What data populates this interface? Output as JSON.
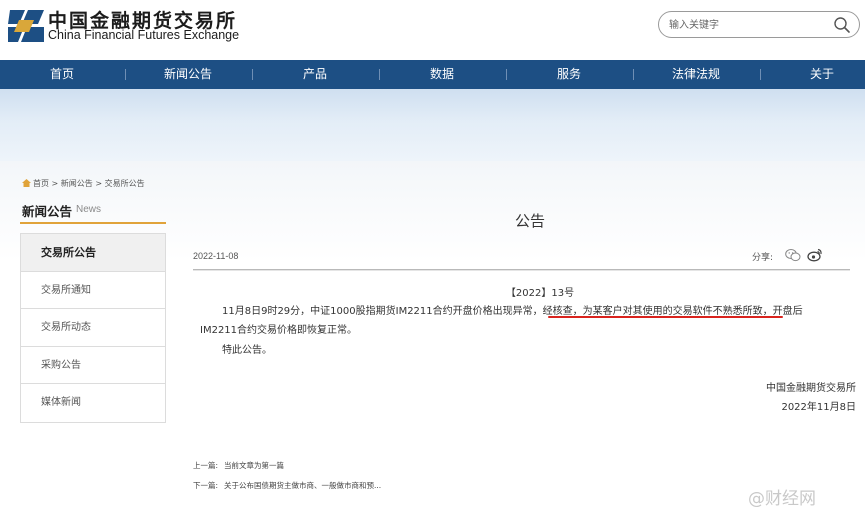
{
  "header": {
    "org_name_cn": "中国金融期货交易所",
    "org_name_en": "China Financial Futures Exchange",
    "search_placeholder": "输入关键字",
    "brand_colors": {
      "primary": "#1d4f84",
      "accent": "#e0a33a",
      "highlight": "#d9231e"
    }
  },
  "nav": {
    "items": [
      {
        "label": "首页"
      },
      {
        "label": "新闻公告"
      },
      {
        "label": "产品"
      },
      {
        "label": "数据"
      },
      {
        "label": "服务"
      },
      {
        "label": "法律法规"
      },
      {
        "label": "关于"
      }
    ]
  },
  "breadcrumb": {
    "home": "首页",
    "sep": ">",
    "level1": "新闻公告",
    "level2": "交易所公告"
  },
  "sidebar": {
    "title": "新闻公告",
    "title_en": "News",
    "items": [
      {
        "label": "交易所公告",
        "active": true
      },
      {
        "label": "交易所通知"
      },
      {
        "label": "交易所动态"
      },
      {
        "label": "采购公告"
      },
      {
        "label": "媒体新闻"
      }
    ]
  },
  "article": {
    "title": "公告",
    "date": "2022-11-08",
    "share_label": "分享:",
    "share_icons": [
      "wechat-icon",
      "weibo-icon"
    ],
    "doc_number": "【2022】13号",
    "para1_line1": "11月8日9时29分，中证1000股指期货IM2211合约开盘价格出现异常，经核查，为某客户对其使用的交易软件不熟悉所致，开盘后",
    "para1_line2": "IM2211合约交易价格即恢复正常。",
    "para2": "特此公告。",
    "signature_org": "中国金融期货交易所",
    "signature_date": "2022年11月8日"
  },
  "pager": {
    "prev_label": "上一篇:",
    "prev_value": "当前文章为第一篇",
    "next_label": "下一篇:",
    "next_value": "关于公布国债期货主做市商、一般做市商和预..."
  },
  "watermark": {
    "text": "@财经网"
  }
}
